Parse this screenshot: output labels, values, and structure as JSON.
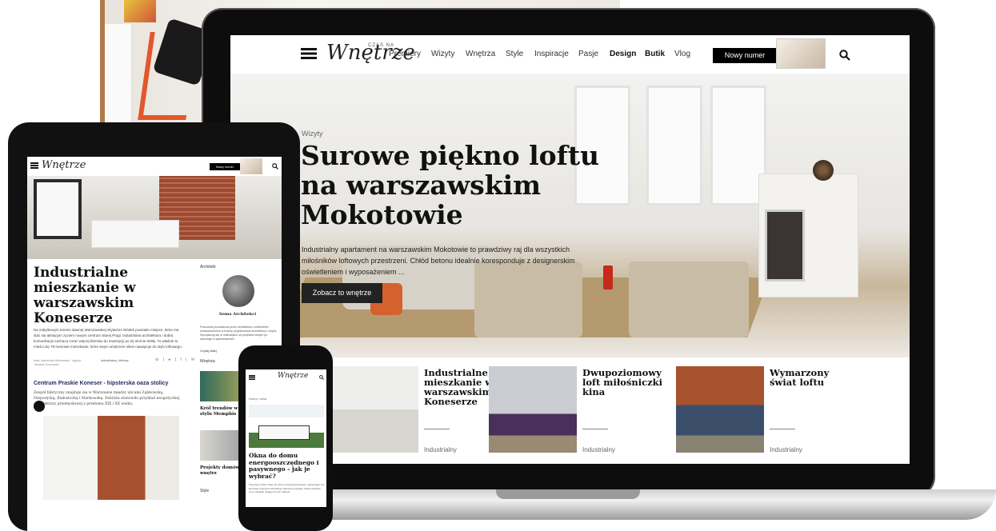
{
  "laptop": {
    "logo": "Wnętrze",
    "logo_prefix": "CZAS NA",
    "nav": [
      "Premiery",
      "Wizyty",
      "Wnętrza",
      "Style",
      "Inspiracje",
      "Pasje",
      "Design",
      "Butik",
      "Vlog"
    ],
    "new_issue_label": "Nowy numer",
    "hero": {
      "category": "Wizyty",
      "title": "Surowe piękno loftu na warszawskim Mokotowie",
      "description": "Industrialny apartament na warszawskim Mokotowie to prawdziwy raj dla wszystkich miłośników loftowych przestrzeni. Chłód betonu idealnie koresponduje z designerskim oświetleniem i wyposażeniem ...",
      "button_label": "Zobacz to wnętrze"
    },
    "cards": [
      {
        "title": "Industrialne mieszkanie w warszawskim Koneserze",
        "tag": "Industrialny"
      },
      {
        "title": "Dwupoziomowy loft miłośniczki kina",
        "tag": "Industrialny"
      },
      {
        "title": "Wymarzony świat loftu",
        "tag": "Industrialny"
      }
    ]
  },
  "tablet": {
    "logo": "Wnętrze",
    "new_issue_label": "Nowy numer",
    "article": {
      "title": "Industrialne mieszkanie w warszawskim Koneserze",
      "description": "Na zabytkowym terenie dawnej Warszawskiej Wytwórni Wódek powstało miejsce, które ma stać się tętniącym życiem nowym centrum Starej Pragi. Industrialna architektura i dobra komunikacja zachęca coraz więcej klientów do inwestycji po tej stronie Wisły. To właśnie tu mieści się 78-metrowe mieszkanie, które swym wnętrzem silnie nawiązuje do stylu loftowego.",
      "byline": "tekst: Agnieszka Wiśniewska · zdjęcia: Jarosław Sosnowski",
      "tag": "industrialny, loftowy",
      "share": "⊘ | ● | f | ✉"
    },
    "section": {
      "title": "Centrum Praskie Koneser - hipsterska oaza stolicy",
      "description": "Zespół fabryczny znajduje się w Warszawie między ulicami Ząbkowską, Nieporęcką, Białostocką i Markowską. Fabryka stanowiła przykład neogotyckiej architektury przemysłowej z przełomu XIX i XX wieku."
    },
    "sidebar": {
      "architect_heading": "Architekt",
      "architect_name": "Soma Architekci",
      "architect_desc": "Pracownia prowadzona przez architektów z wieloletnim doświadczeniem w branży projektowania architektury i wnętrz. Specjalizują się w realizacjach od projektów wnętrz po aranżacje w apartamentach",
      "more_label": "Czytaj dalej",
      "section_heading": "Wnętrza",
      "item1": "Król trendów w stylu Memphis",
      "item2": "Projekty domów i wnętrz",
      "style_heading": "Style"
    }
  },
  "phone": {
    "logo": "Wnętrze",
    "category": "Domy i okna",
    "title": "Okna do domu energooszczędnego i pasywnego - jak je wybrać?",
    "description": "Precyzyjny dobór okien do domu energooszczędnego i pasywnego ma kluczowe znaczenie dla bilansu cieplnego budynku. Warto wiedzieć, na co zwracać uwagę przy ich zakupie."
  },
  "colors": {
    "device_black": "#0d0d0d",
    "button_dark": "#222222",
    "section_blue": "#1d2a5c"
  }
}
